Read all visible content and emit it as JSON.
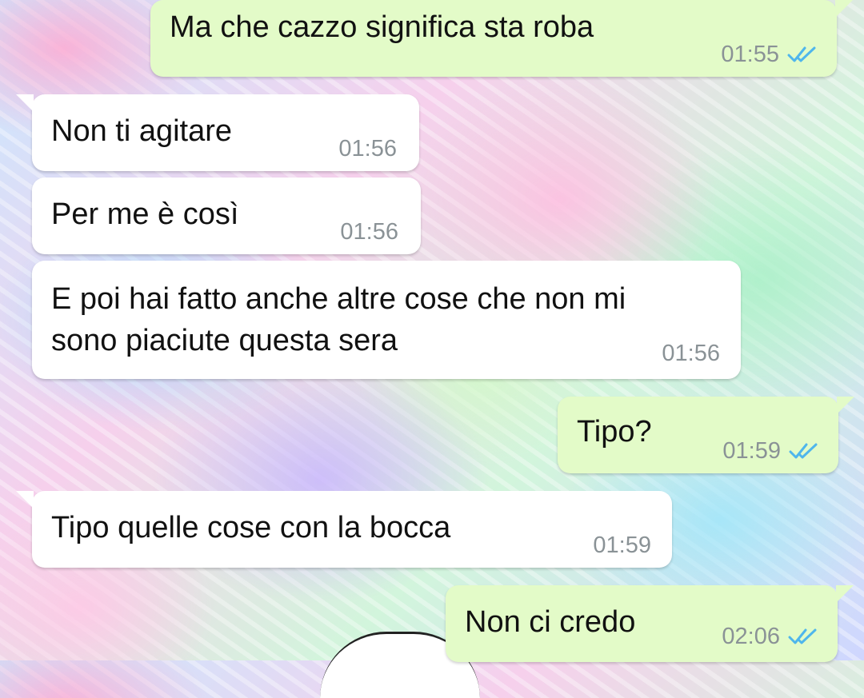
{
  "messages": [
    {
      "direction": "out",
      "text": "Ma che cazzo significa sta roba",
      "time": "01:55",
      "status": "read"
    },
    {
      "direction": "in",
      "text": "Non ti agitare",
      "time": "01:56"
    },
    {
      "direction": "in",
      "text": "Per me è così",
      "time": "01:56"
    },
    {
      "direction": "in",
      "text": "E poi hai fatto anche altre cose che non mi\nsono piaciute questa sera",
      "time": "01:56"
    },
    {
      "direction": "out",
      "text": "Tipo?",
      "time": "01:59",
      "status": "read"
    },
    {
      "direction": "in",
      "text": "Tipo quelle cose con la bocca",
      "time": "01:59"
    },
    {
      "direction": "out",
      "text": "Non ci credo",
      "time": "02:06",
      "status": "read"
    }
  ],
  "colors": {
    "incoming_bubble": "#ffffff",
    "outgoing_bubble": "#e3fbc8",
    "read_ticks": "#4fb6ec",
    "timestamp": "#8a9296"
  },
  "icons": {
    "read_status": "double-check-icon"
  }
}
